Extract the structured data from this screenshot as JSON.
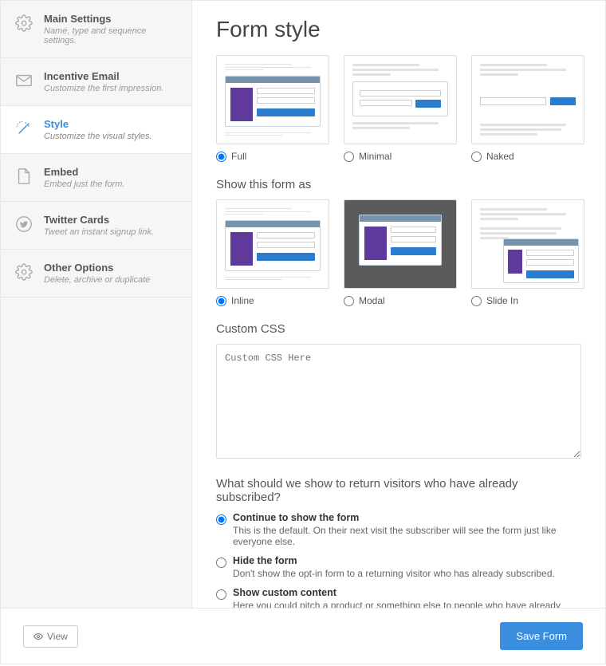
{
  "sidebar": {
    "items": [
      {
        "title": "Main Settings",
        "subtitle": "Name, type and sequence settings."
      },
      {
        "title": "Incentive Email",
        "subtitle": "Customize the first impression."
      },
      {
        "title": "Style",
        "subtitle": "Customize the visual styles."
      },
      {
        "title": "Embed",
        "subtitle": "Embed just the form."
      },
      {
        "title": "Twitter Cards",
        "subtitle": "Tweet an instant signup link."
      },
      {
        "title": "Other Options",
        "subtitle": "Delete, archive or duplicate"
      }
    ]
  },
  "page": {
    "title": "Form style",
    "style_options": [
      {
        "label": "Full"
      },
      {
        "label": "Minimal"
      },
      {
        "label": "Naked"
      }
    ],
    "show_as_header": "Show this form as",
    "show_as_options": [
      {
        "label": "Inline"
      },
      {
        "label": "Modal"
      },
      {
        "label": "Slide In"
      }
    ],
    "custom_css_header": "Custom CSS",
    "custom_css_placeholder": "Custom CSS Here",
    "return_visitor_question": "What should we show to return visitors who have already subscribed?",
    "return_options": [
      {
        "title": "Continue to show the form",
        "desc": "This is the default. On their next visit the subscriber will see the form just like everyone else."
      },
      {
        "title": "Hide the form",
        "desc": "Don't show the opt-in form to a returning visitor who has already subscribed."
      },
      {
        "title": "Show custom content",
        "desc": "Here you could pitch a product or something else to people who have already subscribed."
      }
    ]
  },
  "footer": {
    "view_label": "View",
    "save_label": "Save Form"
  }
}
